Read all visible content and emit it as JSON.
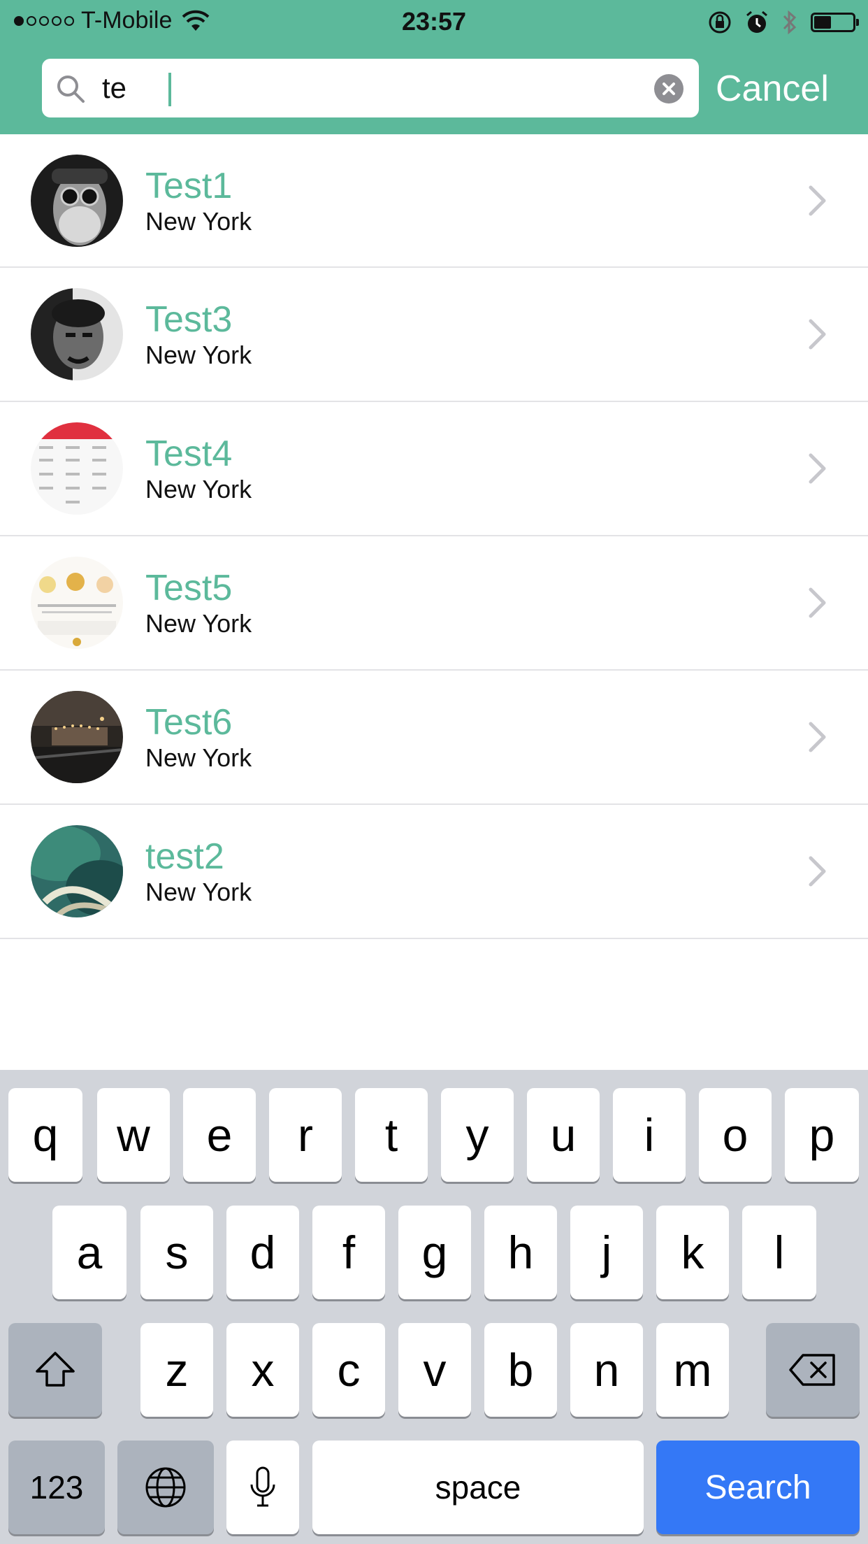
{
  "status_bar": {
    "carrier": "T-Mobile",
    "time": "23:57",
    "signal_bars_filled": 1,
    "signal_bars_total": 5,
    "battery_level": 0.45
  },
  "search": {
    "value": "te",
    "cancel_label": "Cancel"
  },
  "results": [
    {
      "name": "Test1",
      "location": "New York",
      "avatar": "portrait-bw-sunglasses"
    },
    {
      "name": "Test3",
      "location": "New York",
      "avatar": "portrait-bw-man"
    },
    {
      "name": "Test4",
      "location": "New York",
      "avatar": "schedule-screenshot"
    },
    {
      "name": "Test5",
      "location": "New York",
      "avatar": "food-menu-screenshot"
    },
    {
      "name": "Test6",
      "location": "New York",
      "avatar": "night-city-photo"
    },
    {
      "name": "test2",
      "location": "New York",
      "avatar": "ocean-wave-photo"
    }
  ],
  "keyboard": {
    "row1": [
      "q",
      "w",
      "e",
      "r",
      "t",
      "y",
      "u",
      "i",
      "o",
      "p"
    ],
    "row2": [
      "a",
      "s",
      "d",
      "f",
      "g",
      "h",
      "j",
      "k",
      "l"
    ],
    "row3": [
      "z",
      "x",
      "c",
      "v",
      "b",
      "n",
      "m"
    ],
    "numbers_label": "123",
    "space_label": "space",
    "search_label": "Search"
  },
  "colors": {
    "accent": "#5cb99b",
    "search_key": "#3478f6"
  }
}
